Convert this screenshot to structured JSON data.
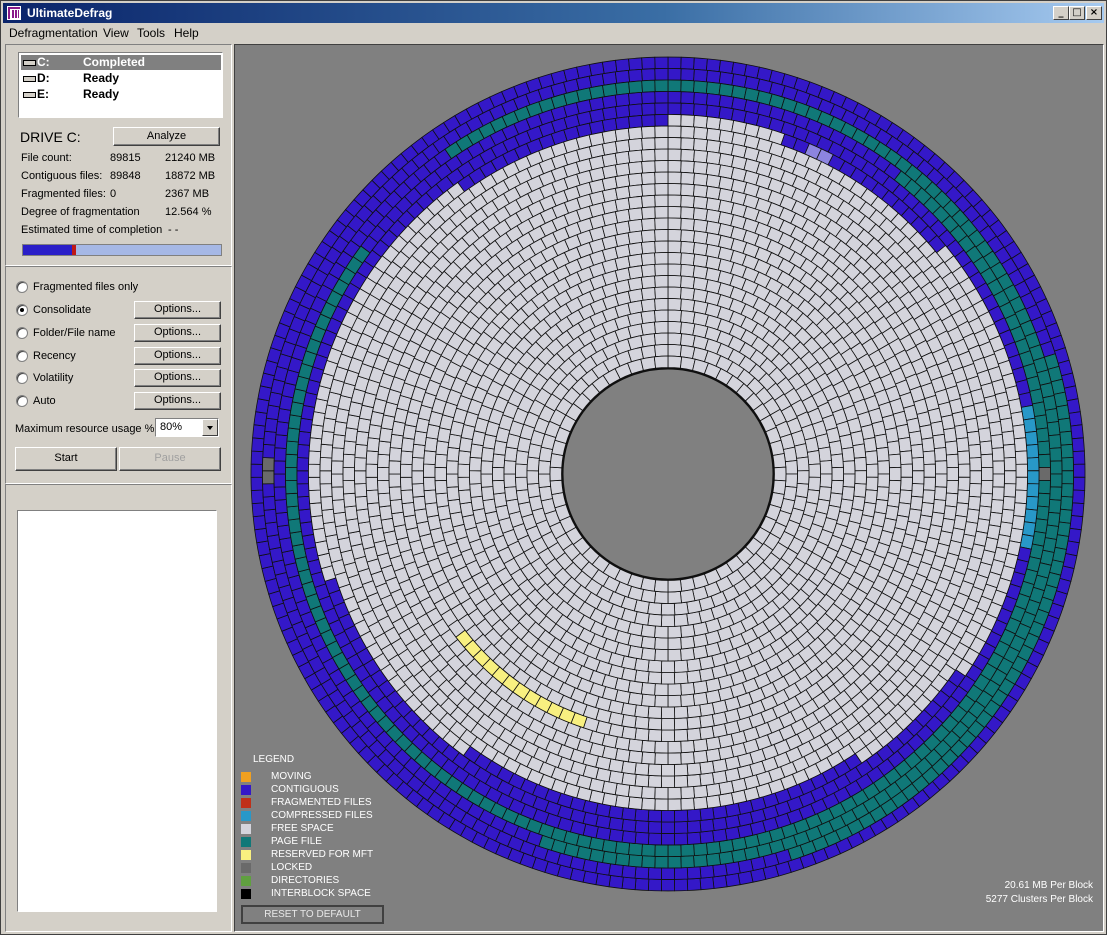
{
  "window": {
    "title": "UltimateDefrag"
  },
  "menu": [
    "Defragmentation",
    "View",
    "Tools",
    "Help"
  ],
  "drives": [
    {
      "letter": "C:",
      "status": "Completed"
    },
    {
      "letter": "D:",
      "status": "Ready"
    },
    {
      "letter": "E:",
      "status": "Ready"
    }
  ],
  "drive_info": {
    "heading": "DRIVE C:",
    "analyze_label": "Analyze",
    "stats": [
      {
        "label": "File count:",
        "v1": "89815",
        "v2": "21240 MB"
      },
      {
        "label": "Contiguous files:",
        "v1": "89848",
        "v2": "18872 MB"
      },
      {
        "label": "Fragmented files:",
        "v1": "0",
        "v2": "2367 MB"
      },
      {
        "label": "Degree of fragmentation",
        "v1": "",
        "v2": "12.564 %"
      },
      {
        "label": "Estimated time of completion",
        "v1": "- -",
        "v2": ""
      }
    ],
    "progress_fraction": 0.27
  },
  "methods": [
    {
      "label": "Fragmented files only",
      "checked": false,
      "options": ""
    },
    {
      "label": "Consolidate",
      "checked": true,
      "options": "Options..."
    },
    {
      "label": "Folder/File name",
      "checked": false,
      "options": "Options..."
    },
    {
      "label": "Recency",
      "checked": false,
      "options": "Options..."
    },
    {
      "label": "Volatility",
      "checked": false,
      "options": "Options..."
    },
    {
      "label": "Auto",
      "checked": false,
      "options": "Options..."
    }
  ],
  "resource": {
    "label": "Maximum resource usage %",
    "value": "80%"
  },
  "controls": {
    "start": "Start",
    "pause": "Pause"
  },
  "legend": {
    "title": "LEGEND",
    "items": [
      {
        "label": "MOVING",
        "color": "#f0a020"
      },
      {
        "label": "CONTIGUOUS",
        "color": "#3418c8"
      },
      {
        "label": "FRAGMENTED FILES",
        "color": "#c03018"
      },
      {
        "label": "COMPRESSED FILES",
        "color": "#2898c8"
      },
      {
        "label": "FREE SPACE",
        "color": "#d4d4dc"
      },
      {
        "label": "PAGE FILE",
        "color": "#107878"
      },
      {
        "label": "RESERVED FOR MFT",
        "color": "#f8f080"
      },
      {
        "label": "LOCKED",
        "color": "#6a6a6a"
      },
      {
        "label": "DIRECTORIES",
        "color": "#60a040"
      },
      {
        "label": "INTERBLOCK SPACE",
        "color": "#000000"
      }
    ],
    "reset_label": "RESET TO DEFAULT"
  },
  "block_info": {
    "mb_per_block": "20.61 MB Per Block",
    "clusters_per_block": "5277 Clusters Per Block"
  },
  "colors": {
    "contiguous": "#3418c8",
    "page_file": "#107878",
    "free": "#d4d4dc",
    "mft": "#f8f080",
    "locked": "#6a6a6a",
    "compressed": "#2898c8",
    "light_contig": "#8c84e0",
    "ring_border": "#101010"
  }
}
